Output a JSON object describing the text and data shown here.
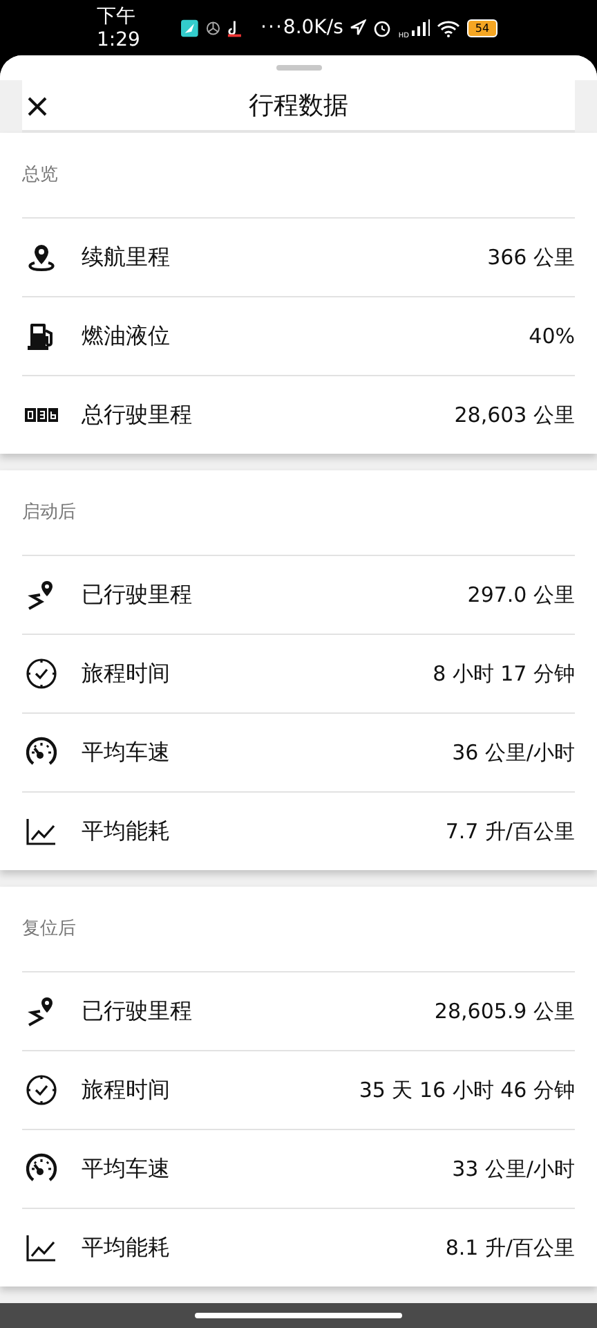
{
  "status_bar": {
    "time": "下午1:29",
    "more": "···",
    "speed": "8.0K/s",
    "signal_badge": "HD",
    "battery": "54"
  },
  "sheet": {
    "title": "行程数据"
  },
  "sections": [
    {
      "title": "总览",
      "rows": [
        {
          "kind": "pin",
          "label": "续航里程",
          "value": "366 公里"
        },
        {
          "kind": "fuel",
          "label": "燃油液位",
          "value": "40%"
        },
        {
          "kind": "odometer",
          "label": "总行驶里程",
          "value": "28,603 公里"
        }
      ]
    },
    {
      "title": "启动后",
      "rows": [
        {
          "kind": "route",
          "label": "已行驶里程",
          "value": "297.0 公里"
        },
        {
          "kind": "clock",
          "label": "旅程时间",
          "value": "8 小时 17 分钟"
        },
        {
          "kind": "speed",
          "label": "平均车速",
          "value": "36 公里/小时"
        },
        {
          "kind": "chart",
          "label": "平均能耗",
          "value": "7.7 升/百公里"
        }
      ]
    },
    {
      "title": "复位后",
      "rows": [
        {
          "kind": "route",
          "label": "已行驶里程",
          "value": "28,605.9 公里"
        },
        {
          "kind": "clock",
          "label": "旅程时间",
          "value": "35 天 16 小时 46 分钟"
        },
        {
          "kind": "speed",
          "label": "平均车速",
          "value": "33 公里/小时"
        },
        {
          "kind": "chart",
          "label": "平均能耗",
          "value": "8.1 升/百公里"
        }
      ]
    }
  ]
}
